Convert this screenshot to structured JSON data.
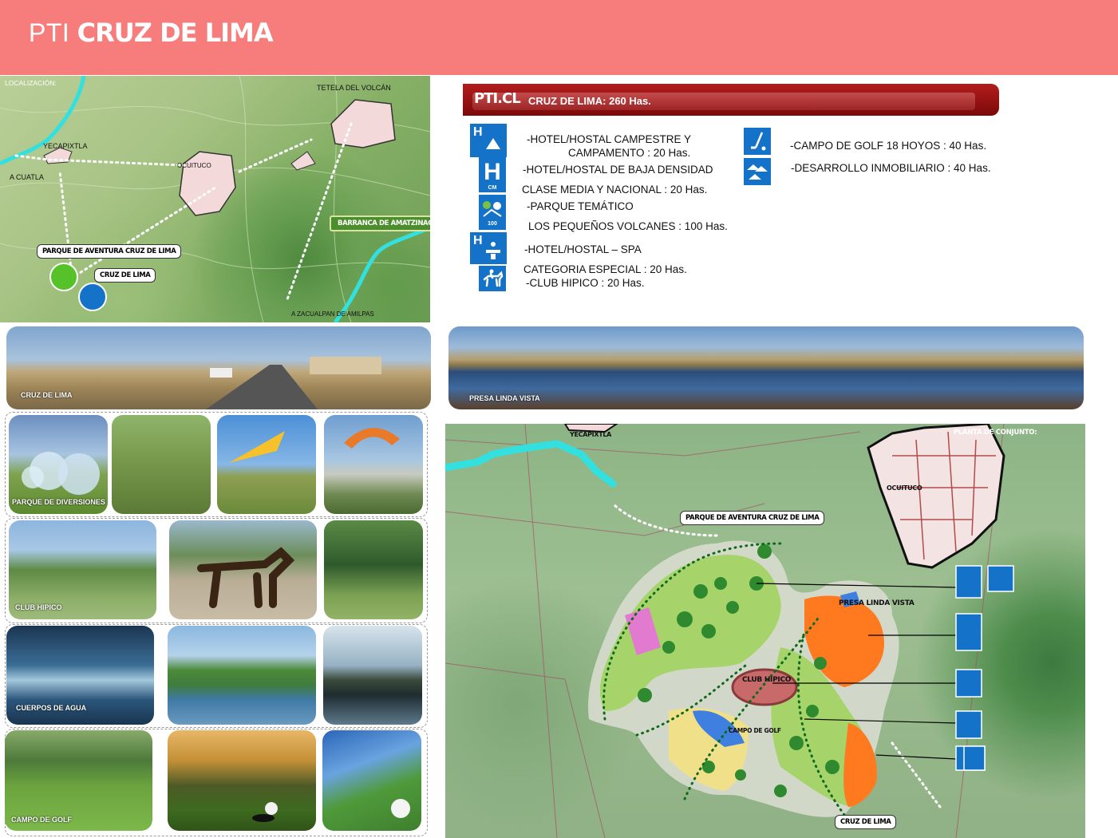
{
  "header": {
    "prefix": "PTI",
    "title": "CRUZ DE LIMA"
  },
  "location_map": {
    "label": "LOCALIZACIÓN:",
    "places": {
      "tetela": "TETELA DEL VOLCÁN",
      "yecapixtla": "YECAPIXTLA",
      "cuatla": "A CUATLA",
      "ocuituco": "OCUITUCO",
      "barranca": "BARRANCA DE AMATZINAC",
      "parque": "PARQUE DE AVENTURA CRUZ DE LIMA",
      "cruz": "CRUZ DE LIMA",
      "zacualpan": "A ZACUALPAN DE AMILPAS"
    }
  },
  "banner": {
    "code": "PTI.CL",
    "subtitle": "CRUZ DE LIMA: 260 Has."
  },
  "legend_left": {
    "l1": "-HOTEL/HOSTAL CAMPESTRE Y",
    "l2": "CAMPAMENTO : 20 Has.",
    "l3": "-HOTEL/HOSTAL DE BAJA DENSIDAD",
    "l4": "CLASE MEDIA Y NACIONAL : 20 Has.",
    "l5": "-PARQUE TEMÁTICO",
    "l6": "LOS PEQUEÑOS VOLCANES : 100 Has.",
    "l7": "-HOTEL/HOSTAL – SPA",
    "l8": "CATEGORIA ESPECIAL : 20 Has.",
    "l9": "-CLUB HIPICO : 20 Has."
  },
  "legend_right": {
    "golf": "-CAMPO DE GOLF 18 HOYOS : 40 Has.",
    "housing": "-DESARROLLO INMOBILIARIO : 40 Has."
  },
  "icons": {
    "h": "H",
    "cm": "CM",
    "n100": "100"
  },
  "photos": {
    "cruz": "CRUZ DE LIMA",
    "presa": "PRESA LINDA VISTA",
    "parque": "PARQUE DE DIVERSIONES",
    "club": "CLUB HIPICO",
    "agua": "CUERPOS DE AGUA",
    "golf": "CAMPO DE GOLF"
  },
  "plan": {
    "title": "PLANTA DE CONJUNTO:",
    "yecapixtla": "YECAPIXTLA",
    "ocuituco": "OCUITUCO",
    "parque": "PARQUE DE AVENTURA CRUZ DE LIMA",
    "presa": "PRESA LINDA VISTA",
    "club": "CLUB HIPICO",
    "golf": "CAMPO DE GOLF",
    "cruz": "CRUZ DE LIMA"
  },
  "colors": {
    "header": "#f77d7d",
    "banner": "#9e1515",
    "icon_blue": "#1473c9",
    "river": "#33e0e0"
  }
}
